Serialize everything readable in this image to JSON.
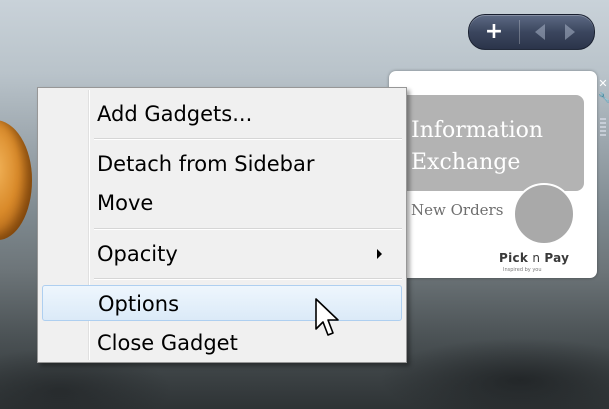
{
  "context_menu": {
    "items": [
      {
        "label": "Add Gadgets..."
      },
      {
        "label": "Detach from Sidebar"
      },
      {
        "label": "Move"
      },
      {
        "label": "Opacity",
        "has_submenu": true
      },
      {
        "label": "Options",
        "highlighted": true
      },
      {
        "label": "Close Gadget"
      }
    ]
  },
  "sidebar_controls": {
    "add_icon": "plus-icon",
    "prev_icon": "chevron-left-icon",
    "next_icon": "chevron-right-icon",
    "add_glyph": "+"
  },
  "gadget": {
    "title": "Information Exchange",
    "subtitle": "New Orders",
    "logo": {
      "part1": "Pick",
      "part2": "n",
      "part3": "Pay"
    },
    "tagline": "Inspired by you",
    "close_glyph": "✕",
    "options_glyph": "🔧",
    "colors": {
      "header": "#b3b3b3",
      "circle": "#a9a9a9"
    }
  },
  "colors": {
    "menu_background": "#f0f0f0",
    "menu_highlight": "#dbeaf8",
    "sidebar_bar": "#3b465e"
  }
}
